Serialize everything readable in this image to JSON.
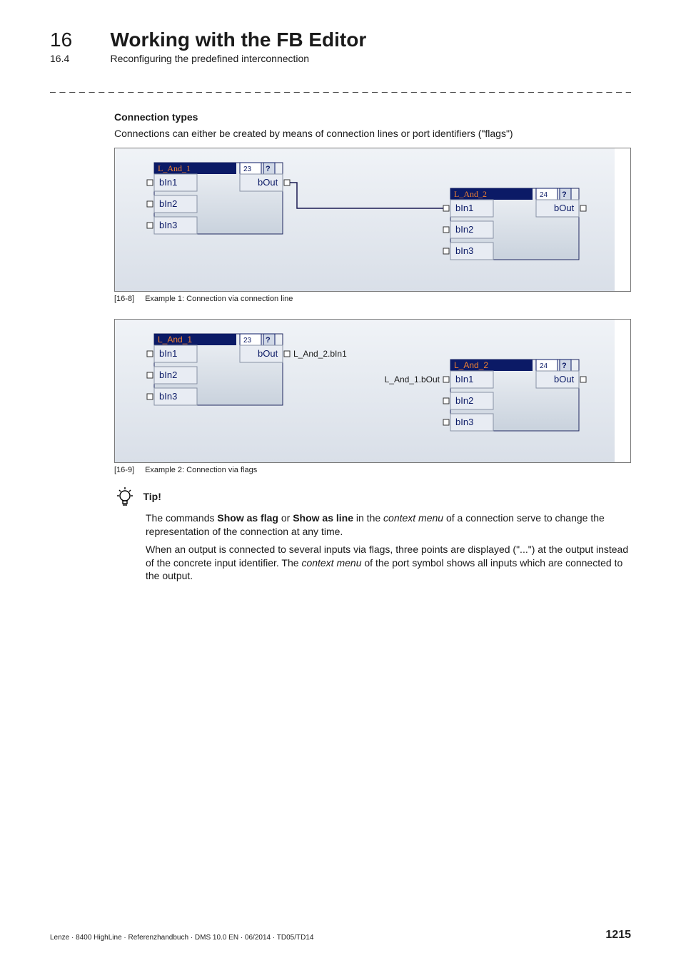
{
  "header": {
    "chapter_no": "16",
    "chapter_title": "Working with the FB Editor",
    "section_no": "16.4",
    "section_title": "Reconfiguring the predefined interconnection",
    "dashes": "_ _ _ _ _ _ _ _ _ _ _ _ _ _ _ _ _ _ _ _ _ _ _ _ _ _ _ _ _ _ _ _ _ _ _ _ _ _ _ _ _ _ _ _ _ _ _ _ _ _ _ _ _ _ _ _ _ _ _ _ _ _ _ _"
  },
  "section": {
    "heading": "Connection types",
    "intro": "Connections can either be created by means of connection lines or port identifiers (\"flags\")"
  },
  "fig1": {
    "tag": "[16-8]",
    "caption": "Example 1: Connection via connection line",
    "b1": {
      "title": "L_And_1",
      "idx": "23",
      "in1": "bIn1",
      "in2": "bIn2",
      "in3": "bIn3",
      "out": "bOut"
    },
    "b2": {
      "title": "L_And_2",
      "idx": "24",
      "in1": "bIn1",
      "in2": "bIn2",
      "in3": "bIn3",
      "out": "bOut"
    }
  },
  "fig2": {
    "tag": "[16-9]",
    "caption": "Example 2: Connection via flags",
    "b1": {
      "title": "L_And_1",
      "idx": "23",
      "in1": "bIn1",
      "in2": "bIn2",
      "in3": "bIn3",
      "out": "bOut",
      "flag_out": "L_And_2.bIn1"
    },
    "b2": {
      "title": "L_And_2",
      "idx": "24",
      "in1": "bIn1",
      "in2": "bIn2",
      "in3": "bIn3",
      "out": "bOut",
      "flag_in": "L_And_1.bOut"
    }
  },
  "tip": {
    "title": "Tip!",
    "p1_a": "The commands ",
    "p1_b": "Show as flag",
    "p1_c": " or ",
    "p1_d": "Show as line",
    "p1_e": " in the ",
    "p1_f": "context menu",
    "p1_g": " of a connection serve to change the representation of the connection at any time.",
    "p2_a": "When an output is connected to several inputs via flags, three points are displayed (\"...\") at the output instead of the concrete input identifier. The ",
    "p2_b": "context menu",
    "p2_c": " of the port symbol shows all inputs which are connected to the output."
  },
  "footer": {
    "left": "Lenze · 8400 HighLine · Referenzhandbuch · DMS 10.0 EN · 06/2014 · TD05/TD14",
    "page": "1215"
  }
}
